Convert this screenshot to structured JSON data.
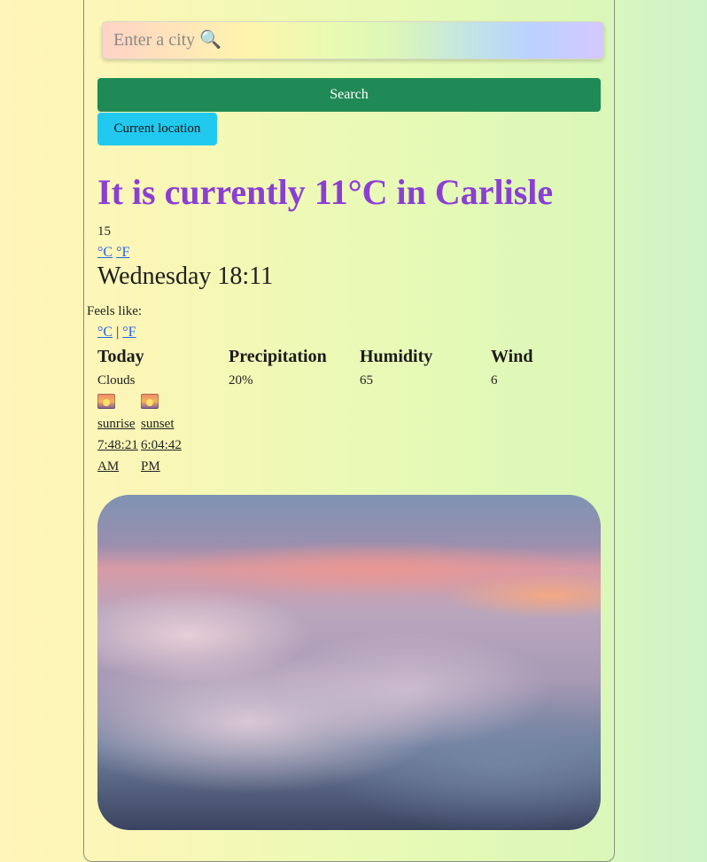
{
  "search": {
    "placeholder": "Enter a city 🔍",
    "button_label": "Search"
  },
  "location_button": {
    "label": "Current location"
  },
  "weather": {
    "headline": "It is currently 11°C in Carlisle",
    "temp_value": "15",
    "unit_c": "°C",
    "unit_f": "°F",
    "datetime": "Wednesday 18:11",
    "feels_like_label": "Feels like:",
    "feels_unit_c": "°C",
    "feels_separator": "|",
    "feels_unit_f": "°F"
  },
  "details": {
    "columns": [
      {
        "header": "Today",
        "value": "Clouds"
      },
      {
        "header": "Precipitation",
        "value": "20%"
      },
      {
        "header": "Humidity",
        "value": "65"
      },
      {
        "header": "Wind",
        "value": "6"
      }
    ]
  },
  "sun": {
    "sunrise_label": "sunrise",
    "sunrise_time": "7:48:21",
    "sunrise_period": "AM",
    "sunset_label": "sunset",
    "sunset_time": "6:04:42",
    "sunset_period": "PM",
    "icon": "sunrise-icon"
  },
  "colors": {
    "headline": "#8a3fd4",
    "search_button": "#1f8a56",
    "location_button": "#22c9ee",
    "link": "#2563eb"
  },
  "image": {
    "subject": "sky-clouds-image"
  }
}
